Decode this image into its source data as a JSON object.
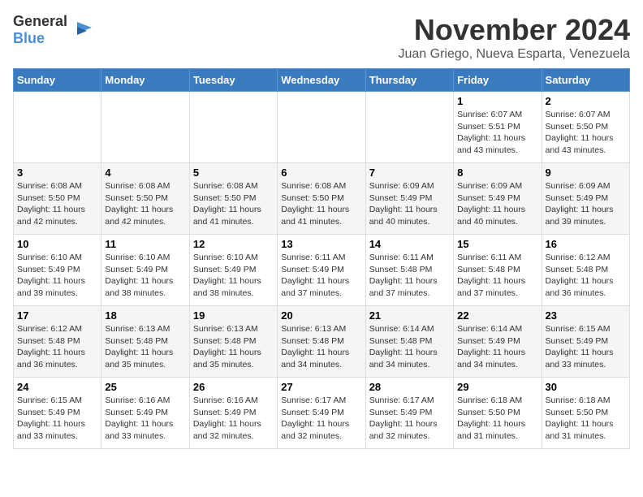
{
  "logo": {
    "general": "General",
    "blue": "Blue"
  },
  "title": "November 2024",
  "location": "Juan Griego, Nueva Esparta, Venezuela",
  "dayHeaders": [
    "Sunday",
    "Monday",
    "Tuesday",
    "Wednesday",
    "Thursday",
    "Friday",
    "Saturday"
  ],
  "weeks": [
    {
      "alt": false,
      "days": [
        {
          "num": "",
          "info": ""
        },
        {
          "num": "",
          "info": ""
        },
        {
          "num": "",
          "info": ""
        },
        {
          "num": "",
          "info": ""
        },
        {
          "num": "",
          "info": ""
        },
        {
          "num": "1",
          "info": "Sunrise: 6:07 AM\nSunset: 5:51 PM\nDaylight: 11 hours\nand 43 minutes."
        },
        {
          "num": "2",
          "info": "Sunrise: 6:07 AM\nSunset: 5:50 PM\nDaylight: 11 hours\nand 43 minutes."
        }
      ]
    },
    {
      "alt": true,
      "days": [
        {
          "num": "3",
          "info": "Sunrise: 6:08 AM\nSunset: 5:50 PM\nDaylight: 11 hours\nand 42 minutes."
        },
        {
          "num": "4",
          "info": "Sunrise: 6:08 AM\nSunset: 5:50 PM\nDaylight: 11 hours\nand 42 minutes."
        },
        {
          "num": "5",
          "info": "Sunrise: 6:08 AM\nSunset: 5:50 PM\nDaylight: 11 hours\nand 41 minutes."
        },
        {
          "num": "6",
          "info": "Sunrise: 6:08 AM\nSunset: 5:50 PM\nDaylight: 11 hours\nand 41 minutes."
        },
        {
          "num": "7",
          "info": "Sunrise: 6:09 AM\nSunset: 5:49 PM\nDaylight: 11 hours\nand 40 minutes."
        },
        {
          "num": "8",
          "info": "Sunrise: 6:09 AM\nSunset: 5:49 PM\nDaylight: 11 hours\nand 40 minutes."
        },
        {
          "num": "9",
          "info": "Sunrise: 6:09 AM\nSunset: 5:49 PM\nDaylight: 11 hours\nand 39 minutes."
        }
      ]
    },
    {
      "alt": false,
      "days": [
        {
          "num": "10",
          "info": "Sunrise: 6:10 AM\nSunset: 5:49 PM\nDaylight: 11 hours\nand 39 minutes."
        },
        {
          "num": "11",
          "info": "Sunrise: 6:10 AM\nSunset: 5:49 PM\nDaylight: 11 hours\nand 38 minutes."
        },
        {
          "num": "12",
          "info": "Sunrise: 6:10 AM\nSunset: 5:49 PM\nDaylight: 11 hours\nand 38 minutes."
        },
        {
          "num": "13",
          "info": "Sunrise: 6:11 AM\nSunset: 5:49 PM\nDaylight: 11 hours\nand 37 minutes."
        },
        {
          "num": "14",
          "info": "Sunrise: 6:11 AM\nSunset: 5:48 PM\nDaylight: 11 hours\nand 37 minutes."
        },
        {
          "num": "15",
          "info": "Sunrise: 6:11 AM\nSunset: 5:48 PM\nDaylight: 11 hours\nand 37 minutes."
        },
        {
          "num": "16",
          "info": "Sunrise: 6:12 AM\nSunset: 5:48 PM\nDaylight: 11 hours\nand 36 minutes."
        }
      ]
    },
    {
      "alt": true,
      "days": [
        {
          "num": "17",
          "info": "Sunrise: 6:12 AM\nSunset: 5:48 PM\nDaylight: 11 hours\nand 36 minutes."
        },
        {
          "num": "18",
          "info": "Sunrise: 6:13 AM\nSunset: 5:48 PM\nDaylight: 11 hours\nand 35 minutes."
        },
        {
          "num": "19",
          "info": "Sunrise: 6:13 AM\nSunset: 5:48 PM\nDaylight: 11 hours\nand 35 minutes."
        },
        {
          "num": "20",
          "info": "Sunrise: 6:13 AM\nSunset: 5:48 PM\nDaylight: 11 hours\nand 34 minutes."
        },
        {
          "num": "21",
          "info": "Sunrise: 6:14 AM\nSunset: 5:48 PM\nDaylight: 11 hours\nand 34 minutes."
        },
        {
          "num": "22",
          "info": "Sunrise: 6:14 AM\nSunset: 5:49 PM\nDaylight: 11 hours\nand 34 minutes."
        },
        {
          "num": "23",
          "info": "Sunrise: 6:15 AM\nSunset: 5:49 PM\nDaylight: 11 hours\nand 33 minutes."
        }
      ]
    },
    {
      "alt": false,
      "days": [
        {
          "num": "24",
          "info": "Sunrise: 6:15 AM\nSunset: 5:49 PM\nDaylight: 11 hours\nand 33 minutes."
        },
        {
          "num": "25",
          "info": "Sunrise: 6:16 AM\nSunset: 5:49 PM\nDaylight: 11 hours\nand 33 minutes."
        },
        {
          "num": "26",
          "info": "Sunrise: 6:16 AM\nSunset: 5:49 PM\nDaylight: 11 hours\nand 32 minutes."
        },
        {
          "num": "27",
          "info": "Sunrise: 6:17 AM\nSunset: 5:49 PM\nDaylight: 11 hours\nand 32 minutes."
        },
        {
          "num": "28",
          "info": "Sunrise: 6:17 AM\nSunset: 5:49 PM\nDaylight: 11 hours\nand 32 minutes."
        },
        {
          "num": "29",
          "info": "Sunrise: 6:18 AM\nSunset: 5:50 PM\nDaylight: 11 hours\nand 31 minutes."
        },
        {
          "num": "30",
          "info": "Sunrise: 6:18 AM\nSunset: 5:50 PM\nDaylight: 11 hours\nand 31 minutes."
        }
      ]
    }
  ]
}
